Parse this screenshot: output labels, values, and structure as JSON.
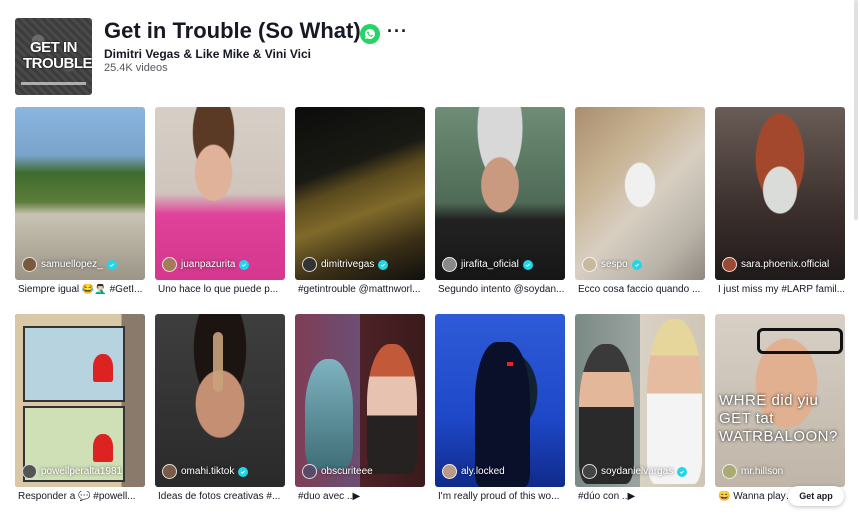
{
  "header": {
    "cover_text": "GET IN TROUBLE",
    "title": "Get in Trouble (So What)",
    "artist": "Dimitri Vegas & Like Mike & Vini Vici",
    "videos_count": "25.4K videos",
    "share_icon": "whatsapp-icon",
    "more_icon": "more-icon",
    "more_label": "···"
  },
  "colors": {
    "share": "#25d366",
    "verified": "#20d5ec",
    "text": "#161823",
    "muted": "#57585e"
  },
  "videos": [
    {
      "username": "samuellopez_",
      "verified": true,
      "caption": "Siempre igual 😂🤦🏻‍♂️ #GetI..."
    },
    {
      "username": "juanpazurita",
      "verified": true,
      "caption": "Uno hace lo que puede p..."
    },
    {
      "username": "dimitrivegas",
      "verified": true,
      "caption": "#getintrouble @mattnworl..."
    },
    {
      "username": "jirafita_oficial",
      "verified": true,
      "caption": "Segundo intento @soydan..."
    },
    {
      "username": "sespo",
      "verified": true,
      "caption": "Ecco cosa faccio quando ..."
    },
    {
      "username": "sara.phoenix.official",
      "verified": false,
      "caption": "I just miss my #LARP famil..."
    },
    {
      "username": "powellperalta1981",
      "verified": false,
      "caption": "Responder a 💬 #powell..."
    },
    {
      "username": "omahi.tiktok",
      "verified": true,
      "caption": "Ideas de fotos creativas #..."
    },
    {
      "username": "obscuriteee",
      "verified": false,
      "caption": "#duo avec ..▶"
    },
    {
      "username": "aly.locked",
      "verified": false,
      "caption": "I'm really proud of this wo..."
    },
    {
      "username": "soydanielvargas",
      "verified": true,
      "caption": "#dúo con ..▶"
    },
    {
      "username": "mr.hillson",
      "verified": false,
      "caption": "😄 Wanna play 'W...",
      "overlay": "WHRE did yiu GET tat WATRBALOON?"
    }
  ],
  "get_app": "Get app"
}
